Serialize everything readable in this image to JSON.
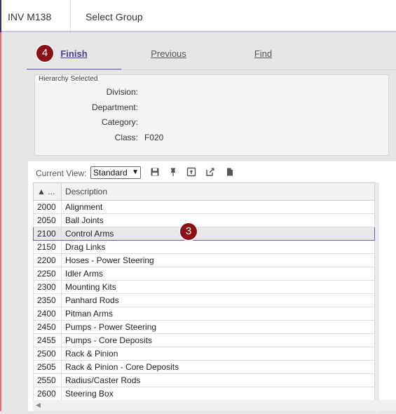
{
  "window": {
    "code": "INV M138",
    "title": "Select Group"
  },
  "tabs": [
    {
      "label": "Finish",
      "active": true,
      "step_badge": "4"
    },
    {
      "label": "Previous",
      "active": false
    },
    {
      "label": "Find",
      "active": false
    }
  ],
  "hierarchy": {
    "legend": "Hierarchy Selected",
    "fields": [
      {
        "label": "Division:",
        "value": ""
      },
      {
        "label": "Department:",
        "value": ""
      },
      {
        "label": "Category:",
        "value": ""
      },
      {
        "label": "Class:",
        "value": "F020"
      }
    ]
  },
  "grid": {
    "current_view_label": "Current View:",
    "current_view_value": "Standard",
    "toolbar_icons": [
      "save-icon",
      "pin-icon",
      "upload-icon",
      "export-icon",
      "document-icon"
    ],
    "columns": [
      "▲ ...",
      "Description"
    ],
    "selected_badge": "3",
    "rows": [
      {
        "code": "2000",
        "description": "Alignment"
      },
      {
        "code": "2050",
        "description": "Ball Joints"
      },
      {
        "code": "2100",
        "description": "Control Arms",
        "selected": true
      },
      {
        "code": "2150",
        "description": "Drag Links"
      },
      {
        "code": "2200",
        "description": "Hoses - Power Steering"
      },
      {
        "code": "2250",
        "description": "Idler Arms"
      },
      {
        "code": "2300",
        "description": "Mounting Kits"
      },
      {
        "code": "2350",
        "description": "Panhard Rods"
      },
      {
        "code": "2400",
        "description": "Pitman Arms"
      },
      {
        "code": "2450",
        "description": "Pumps - Power Steering"
      },
      {
        "code": "2455",
        "description": "Pumps - Core Deposits"
      },
      {
        "code": "2500",
        "description": "Rack & Pinion"
      },
      {
        "code": "2505",
        "description": "Rack & Pinion - Core Deposits"
      },
      {
        "code": "2550",
        "description": "Radius/Caster Rods"
      },
      {
        "code": "2600",
        "description": "Steering Box"
      }
    ]
  },
  "colors": {
    "accent": "#6c5bb5",
    "badge": "#8a1118",
    "left_edge": "#e0707c"
  }
}
